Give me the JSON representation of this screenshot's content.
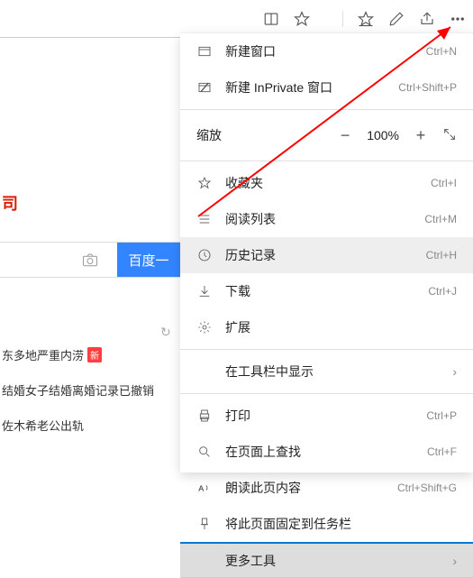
{
  "logo_text": "司",
  "search_button": "百度一",
  "news": [
    {
      "text": "东多地严重内涝",
      "badge": "新"
    },
    {
      "text": "结婚女子结婚离婚记录已撤销",
      "badge": null
    },
    {
      "text": "佐木希老公出轨",
      "badge": null
    }
  ],
  "menu": {
    "new_window": {
      "label": "新建窗口",
      "shortcut": "Ctrl+N"
    },
    "new_inprivate": {
      "label": "新建 InPrivate 窗口",
      "shortcut": "Ctrl+Shift+P"
    },
    "zoom": {
      "label": "缩放",
      "value": "100%"
    },
    "favorites": {
      "label": "收藏夹",
      "shortcut": "Ctrl+I"
    },
    "reading_list": {
      "label": "阅读列表",
      "shortcut": "Ctrl+M"
    },
    "history": {
      "label": "历史记录",
      "shortcut": "Ctrl+H"
    },
    "downloads": {
      "label": "下载",
      "shortcut": "Ctrl+J"
    },
    "extensions": {
      "label": "扩展"
    },
    "show_in_toolbar": {
      "label": "在工具栏中显示"
    },
    "print": {
      "label": "打印",
      "shortcut": "Ctrl+P"
    },
    "find": {
      "label": "在页面上查找",
      "shortcut": "Ctrl+F"
    },
    "read_aloud": {
      "label": "朗读此页内容",
      "shortcut": "Ctrl+Shift+G"
    },
    "pin_taskbar": {
      "label": "将此页面固定到任务栏"
    },
    "more_tools": {
      "label": "更多工具"
    }
  }
}
